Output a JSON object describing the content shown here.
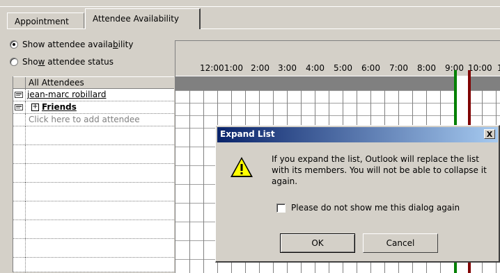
{
  "tabs": [
    {
      "label": "Appointment",
      "active": false
    },
    {
      "label": "Attendee Availability",
      "active": true
    }
  ],
  "view_options": {
    "show_availability": {
      "before": "Show attendee availa",
      "accel": "b",
      "after": "ility",
      "selected": true
    },
    "show_status": {
      "before": "Sho",
      "accel": "w",
      "after": " attendee status",
      "selected": false
    }
  },
  "attendees": {
    "header": "All Attendees",
    "rows": [
      {
        "name": "jean-marc robillard",
        "type": "person"
      },
      {
        "name": "Friends",
        "type": "distribution-list"
      }
    ],
    "add_placeholder": "Click here to add attendee"
  },
  "timeline": {
    "times": [
      "12:00",
      "1:00",
      "2:00",
      "3:00",
      "4:00",
      "5:00",
      "6:00",
      "7:00",
      "8:00",
      "9:00",
      "10:00",
      "1"
    ]
  },
  "dialog": {
    "title": "Expand List",
    "close_label": "X",
    "icon": "warning-icon",
    "message": "If you expand the list, Outlook will replace the list with its members.  You will not be able to collapse it again.",
    "checkbox_label": "Please do not show me this dialog again",
    "checkbox_checked": false,
    "ok_label": "OK",
    "cancel_label": "Cancel"
  },
  "colors": {
    "title_bar": "#0a246a",
    "start_marker": "#008000",
    "end_marker": "#800000"
  }
}
